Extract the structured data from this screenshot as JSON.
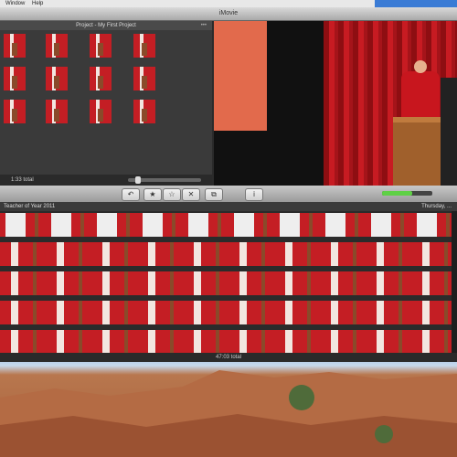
{
  "menubar": {
    "items": [
      "Window",
      "Help"
    ]
  },
  "window": {
    "title": "iMovie"
  },
  "project": {
    "title": "Project - My First Project",
    "duration": "1:33 total",
    "more": "•••"
  },
  "event": {
    "title": "Teacher of Year 2011",
    "date": "Thursday, ...",
    "duration": "47:03 total"
  },
  "toolbar": {
    "buttons": [
      {
        "name": "undo-button",
        "glyph": "↶"
      },
      {
        "name": "favorite-button",
        "glyph": "★"
      },
      {
        "name": "unmark-button",
        "glyph": "☆"
      },
      {
        "name": "reject-button",
        "glyph": "✕"
      },
      {
        "name": "crop-button",
        "glyph": "⧉"
      },
      {
        "name": "info-button",
        "glyph": "i"
      }
    ],
    "volume_level": 0.6
  },
  "colors": {
    "curtain": "#c71b22",
    "accent": "#5fd046",
    "title_bar": "#bfbfbf"
  }
}
